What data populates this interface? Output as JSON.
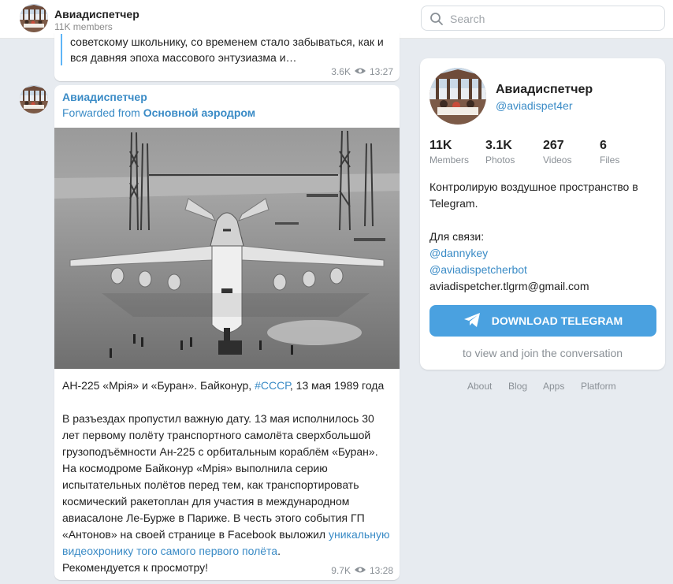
{
  "header": {
    "channel_title": "Авиадиспетчер",
    "members": "11K members",
    "search_placeholder": "Search"
  },
  "messages": [
    {
      "quote_line1": "советскому школьнику, со временем стало забываться, как и",
      "quote_line2": "вся давняя эпоха массового энтузиазма и…",
      "views": "3.6K",
      "time": "13:27"
    },
    {
      "author": "Авиадиспетчер",
      "forwarded_prefix": "Forwarded from",
      "forwarded_source": "Основной аэродром",
      "caption_prefix": "АН-225 «Мрія» и «Буран». Байконур,",
      "hashtag": "#СССР",
      "caption_suffix": ", 13 мая 1989 года",
      "body": "В разъездах пропустил важную дату. 13 мая исполнилось 30 лет первому полёту транспортного самолёта сверхбольшой грузоподъёмности Ан-225 с орбитальным кораблём «Буран». На космодроме Байконур «Мрія» выполнила серию испытательных полётов перед тем, как транспортировать космический ракетоплан для участия в международном авиасалоне Ле-Бурже в Париже. В честь этого события ГП «Антонов» на своей странице в Facebook выложил",
      "link_text": "уникальную видеохронику того самого первого полёта",
      "body_end": ".",
      "closing": "Рекомендуется к просмотру!",
      "views": "9.7K",
      "time": "13:28"
    }
  ],
  "channel_card": {
    "title": "Авиадиспетчер",
    "handle": "@aviadispet4er",
    "stats": [
      {
        "value": "11K",
        "label": "Members"
      },
      {
        "value": "3.1K",
        "label": "Photos"
      },
      {
        "value": "267",
        "label": "Videos"
      },
      {
        "value": "6",
        "label": "Files"
      }
    ],
    "description_line": "Контролирую воздушное пространство в Telegram.",
    "contacts_label": "Для связи:",
    "contact_1": "@dannykey",
    "contact_2": "@aviadispetcherbot",
    "contact_email": "aviadispetcher.tlgrm@gmail.com",
    "download_label": "DOWNLOAD TELEGRAM",
    "view_text": "to view and join the conversation"
  },
  "footer_links": [
    "About",
    "Blog",
    "Apps",
    "Platform"
  ],
  "colors": {
    "background": "#e7ebf0",
    "accent_link": "#3a8bc6",
    "button": "#4aa1e0",
    "quote_bar": "#5eb5f7"
  }
}
